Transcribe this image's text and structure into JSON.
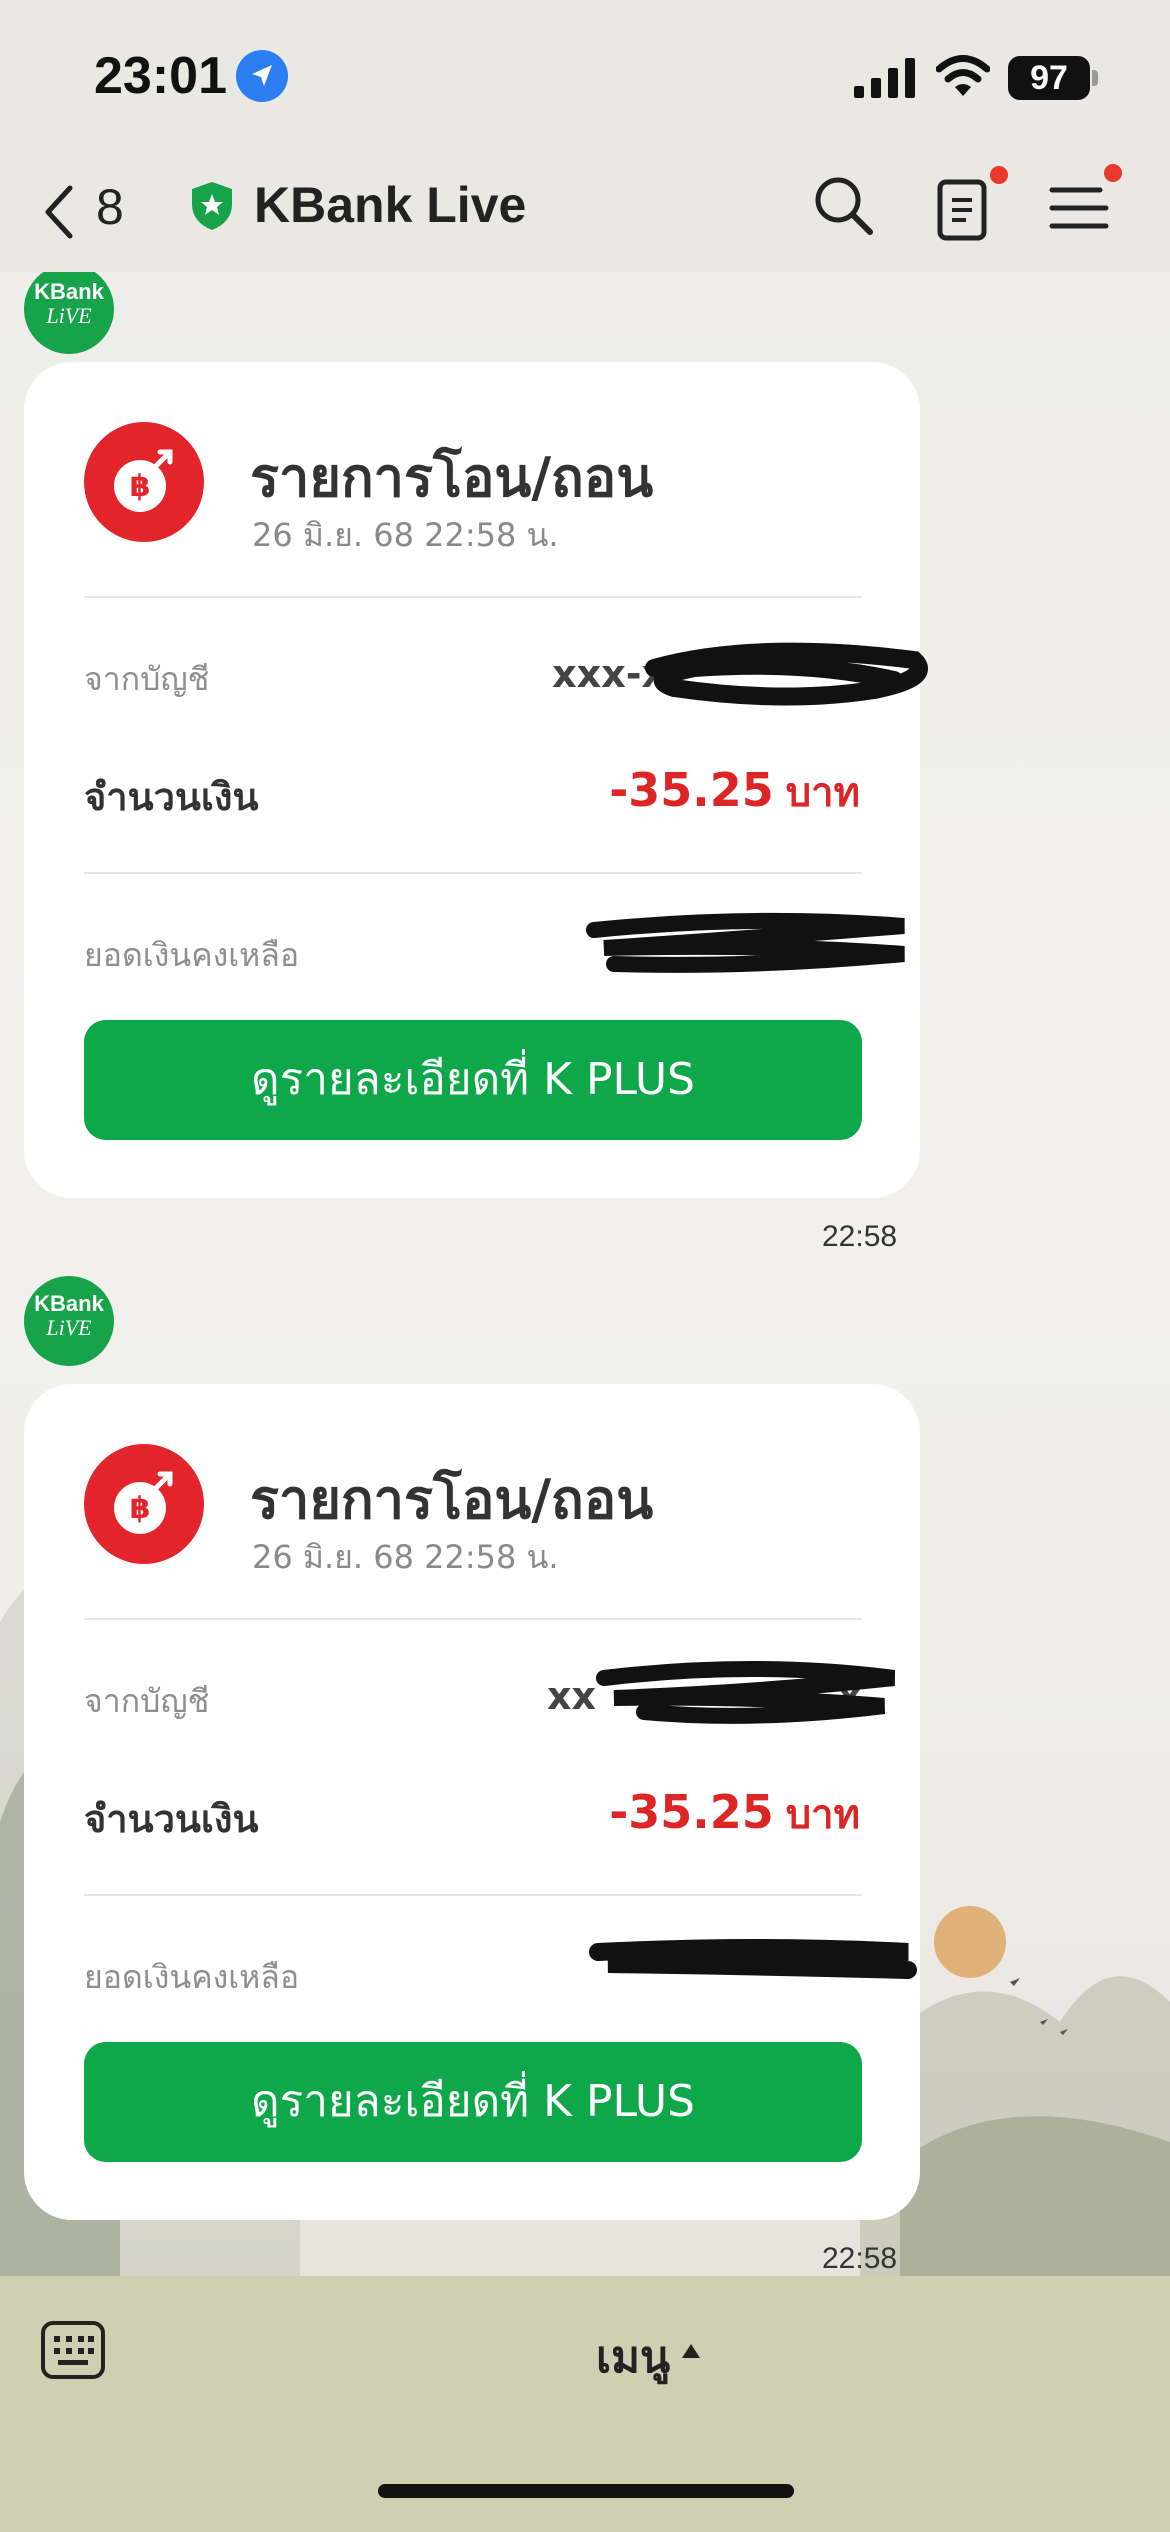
{
  "status": {
    "time": "23:01",
    "battery": "97"
  },
  "nav": {
    "back_count": "8",
    "title": "KBank Live"
  },
  "avatar": {
    "line1": "KBank",
    "line2": "LiVE"
  },
  "messages": [
    {
      "title": "รายการโอน/ถอน",
      "datetime": "26 มิ.ย. 68 22:58  น.",
      "from_label": "จากบัญชี",
      "account_visible": "xxx-x",
      "amount_label": "จำนวนเงิน",
      "amount": "-35.25",
      "currency": "บาท",
      "balance_label": "ยอดเงินคงเหลือ",
      "button": "ดูรายละเอียดที่ K PLUS",
      "time": "22:58"
    },
    {
      "title": "รายการโอน/ถอน",
      "datetime": "26 มิ.ย. 68 22:58  น.",
      "from_label": "จากบัญชี",
      "account_visible": "xx",
      "account_tail": "x",
      "amount_label": "จำนวนเงิน",
      "amount": "-35.25",
      "currency": "บาท",
      "balance_label": "ยอดเงินคงเหลือ",
      "button": "ดูรายละเอียดที่ K PLUS",
      "time": "22:58"
    }
  ],
  "bottom": {
    "menu_label": "เมนู"
  },
  "colors": {
    "brand_green": "#0ea84b",
    "amount_red": "#dc2626",
    "icon_red": "#e3242b"
  }
}
